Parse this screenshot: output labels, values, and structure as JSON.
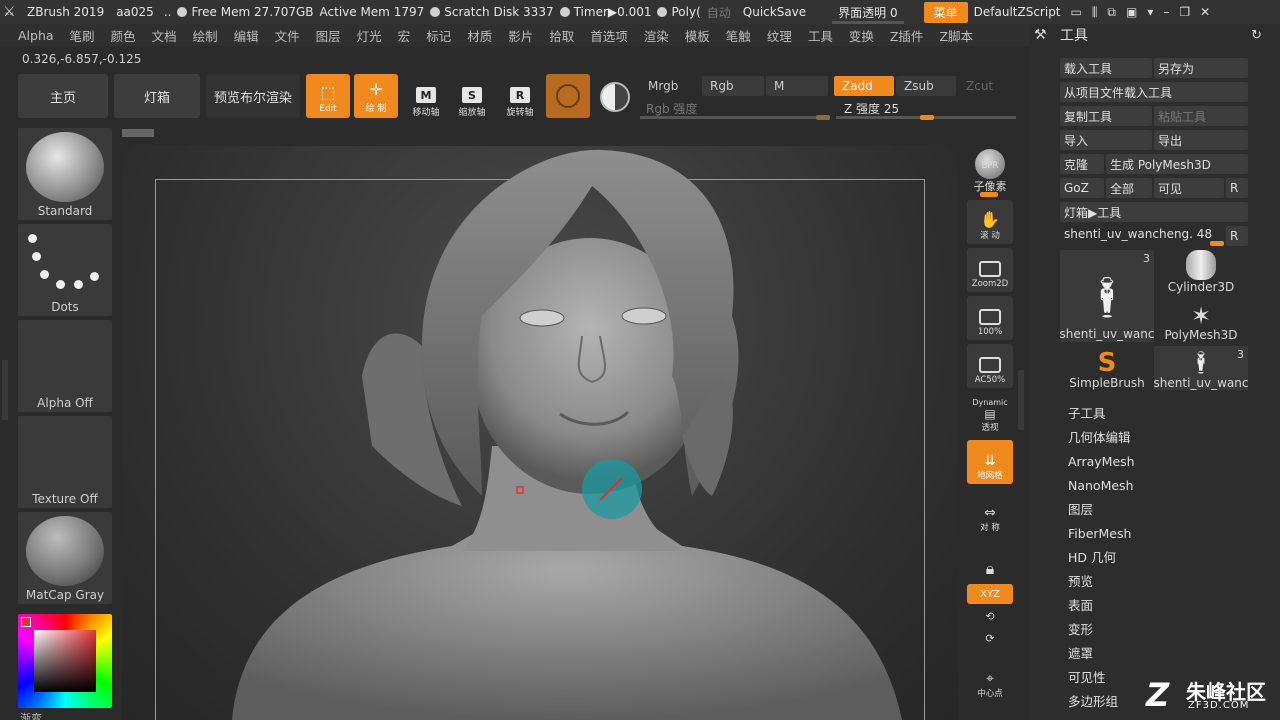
{
  "titlebar": {
    "app": "ZBrush 2019",
    "doc": "aa025",
    "ellipsis": "..",
    "free_mem": "Free Mem 27.707GB",
    "active_mem": "Active Mem 1797",
    "scratch": "Scratch Disk 3337",
    "timer": "Timer▶0.001",
    "poly": "Poly(",
    "auto": "自动",
    "quicksave": "QuickSave",
    "transparency": "界面透明 0",
    "menu": "菜单",
    "script": "DefaultZScript"
  },
  "menubar": [
    "Alpha",
    "笔刷",
    "颜色",
    "文档",
    "绘制",
    "编辑",
    "文件",
    "图层",
    "灯光",
    "宏",
    "标记",
    "材质",
    "影片",
    "拾取",
    "首选项",
    "渲染",
    "模板",
    "笔触",
    "纹理",
    "工具",
    "变换",
    "Z插件",
    "Z脚本"
  ],
  "coords": "0.326,-6.857,-0.125",
  "toolbar": {
    "home": "主页",
    "lightbox": "灯箱",
    "bpr_preview": "预览布尔渲染",
    "edit": "Edit",
    "draw": "绘 制",
    "move": "移动轴",
    "scale": "缩放轴",
    "rotate": "旋转轴",
    "mrgb": "Mrgb",
    "rgb": "Rgb",
    "m": "M",
    "zadd": "Zadd",
    "zsub": "Zsub",
    "zcut": "Zcut",
    "rgb_intensity": "Rgb 强度",
    "z_intensity": "Z 强度 25"
  },
  "left_shelf": {
    "brush": "Standard",
    "stroke": "Dots",
    "alpha": "Alpha Off",
    "texture": "Texture Off",
    "material": "MatCap Gray",
    "gradient": "渐变"
  },
  "right_bar": {
    "bpr": "BPR",
    "subpixel": "子像素",
    "scroll": "滚 动",
    "zoom2d": "Zoom2D",
    "p100": "100%",
    "ac50": "AC50%",
    "dynamic": "Dynamic",
    "persp": "透视",
    "floor": "地网格",
    "frame": "对 称",
    "xyz": "XYZ",
    "center": "中心点"
  },
  "tool_panel": {
    "title": "工具",
    "load_tool": "载入工具",
    "save_as": "另存为",
    "load_from_project": "从项目文件载入工具",
    "copy_tool": "复制工具",
    "paste_tool": "粘贴工具",
    "import": "导入",
    "export": "导出",
    "clone": "克隆",
    "make_polymesh": "生成 PolyMesh3D",
    "goz": "GoZ",
    "all": "全部",
    "visible": "可见",
    "r": "R",
    "lightbox_tool": "灯箱▶工具",
    "current_tool": "shenti_uv_wancheng. 48",
    "thumbs": [
      {
        "name": "shenti_uv_wanc",
        "count": "3"
      },
      {
        "name": "Cylinder3D",
        "count": ""
      },
      {
        "name": "PolyMesh3D",
        "count": ""
      },
      {
        "name": "SimpleBrush",
        "count": ""
      },
      {
        "name": "shenti_uv_wanc",
        "count": "3"
      }
    ],
    "menu": [
      "子工具",
      "几何体编辑",
      "ArrayMesh",
      "NanoMesh",
      "图层",
      "FiberMesh",
      "HD 几何",
      "预览",
      "表面",
      "变形",
      "遮罩",
      "可见性",
      "多边形组"
    ]
  },
  "watermark": {
    "brand": "朱峰社区",
    "site": "ZF3D.COM"
  },
  "colors": {
    "accent": "#f08a1f",
    "brush_cursor": "#1a9aa0"
  }
}
